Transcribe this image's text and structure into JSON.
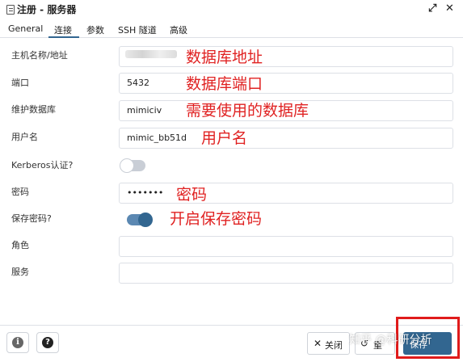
{
  "dialog": {
    "title": "注册 - 服务器",
    "expand_icon": "expand-arrows-icon",
    "close_icon": "close-x-icon"
  },
  "tabs": [
    {
      "label": "General"
    },
    {
      "label": "连接",
      "active": true
    },
    {
      "label": "参数"
    },
    {
      "label": "SSH 隧道"
    },
    {
      "label": "高级"
    }
  ],
  "fields": {
    "host": {
      "label": "主机名称/地址",
      "value": ""
    },
    "port": {
      "label": "端口",
      "value": "5432"
    },
    "maintenance_db": {
      "label": "维护数据库",
      "value": "mimiciv"
    },
    "username": {
      "label": "用户名",
      "value": "mimic_bb51d"
    },
    "kerberos": {
      "label": "Kerberos认证?",
      "on": false
    },
    "password": {
      "label": "密码",
      "value": "•••••••"
    },
    "save_password": {
      "label": "保存密码?",
      "on": true
    },
    "role": {
      "label": "角色",
      "value": ""
    },
    "service": {
      "label": "服务",
      "value": ""
    }
  },
  "annotations": {
    "host": "数据库地址",
    "port": "数据库端口",
    "database": "需要使用的数据库",
    "username": "用户名",
    "password": "密码",
    "save_password": "开启保存密码"
  },
  "footer": {
    "info_icon": "info-icon",
    "help_icon": "help-question-icon",
    "close_label": "关闭",
    "reset_label": "重",
    "save_label": "保存",
    "watermark": "知乎 @科研分析"
  },
  "colors": {
    "accent": "#326690",
    "annotation": "#e02222",
    "highlight_box": "#e01b1b"
  }
}
